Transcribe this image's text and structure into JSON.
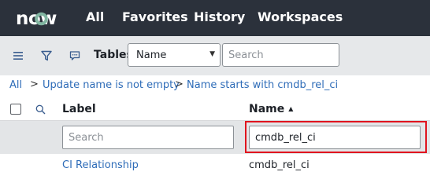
{
  "topbar": {
    "logo_text": "now",
    "nav": [
      "All",
      "Favorites",
      "History",
      "Workspaces"
    ]
  },
  "toolbar": {
    "icons": [
      "hamburger-menu-icon",
      "filter-icon",
      "chat-icon"
    ],
    "tables_label": "Tables",
    "select_value": "Name",
    "search_placeholder": "Search"
  },
  "breadcrumb": {
    "items": [
      "All",
      "Update name is not empty",
      "Name starts with cmdb_rel_ci"
    ],
    "separator": ">"
  },
  "table": {
    "columns": [
      {
        "label": "Label"
      },
      {
        "label": "Name",
        "sort": "ascending",
        "sort_glyph": "▲"
      }
    ],
    "filter": {
      "label_placeholder": "Search",
      "name_value": "cmdb_rel_ci"
    },
    "rows": [
      {
        "label": "CI Relationship",
        "name": "cmdb_rel_ci"
      }
    ]
  },
  "colors": {
    "topbar_bg": "#2b313b",
    "toolbar_bg": "#e6e8ea",
    "link": "#2e6cb8",
    "highlight": "#e0141e"
  }
}
